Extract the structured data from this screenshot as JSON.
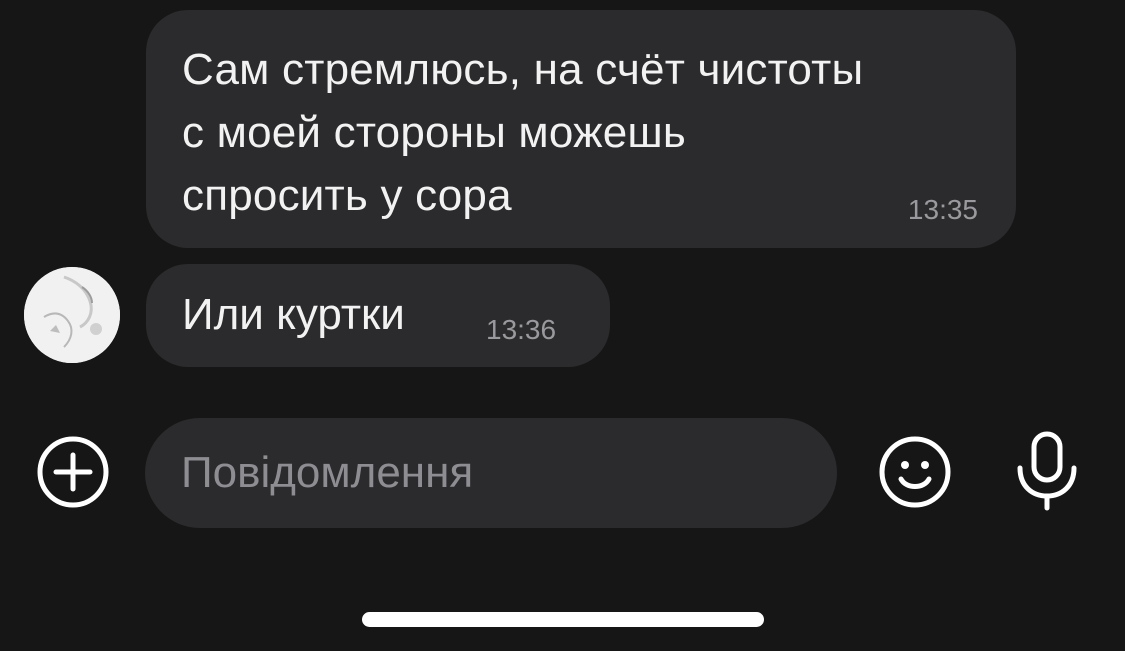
{
  "messages": [
    {
      "text": "Сам стремлюсь, на счёт чистоты\nс моей стороны можешь\nспросить у сора",
      "time": "13:35"
    },
    {
      "text": "Или куртки",
      "time": "13:36"
    }
  ],
  "composer": {
    "placeholder": "Повідомлення",
    "value": ""
  },
  "icons": {
    "attach": "plus-circle-icon",
    "emoji": "smiley-icon",
    "voice": "microphone-icon"
  },
  "colors": {
    "background": "#161616",
    "bubble": "#2b2b2d",
    "text": "#f2f2f2",
    "time": "#9a9a9e"
  }
}
